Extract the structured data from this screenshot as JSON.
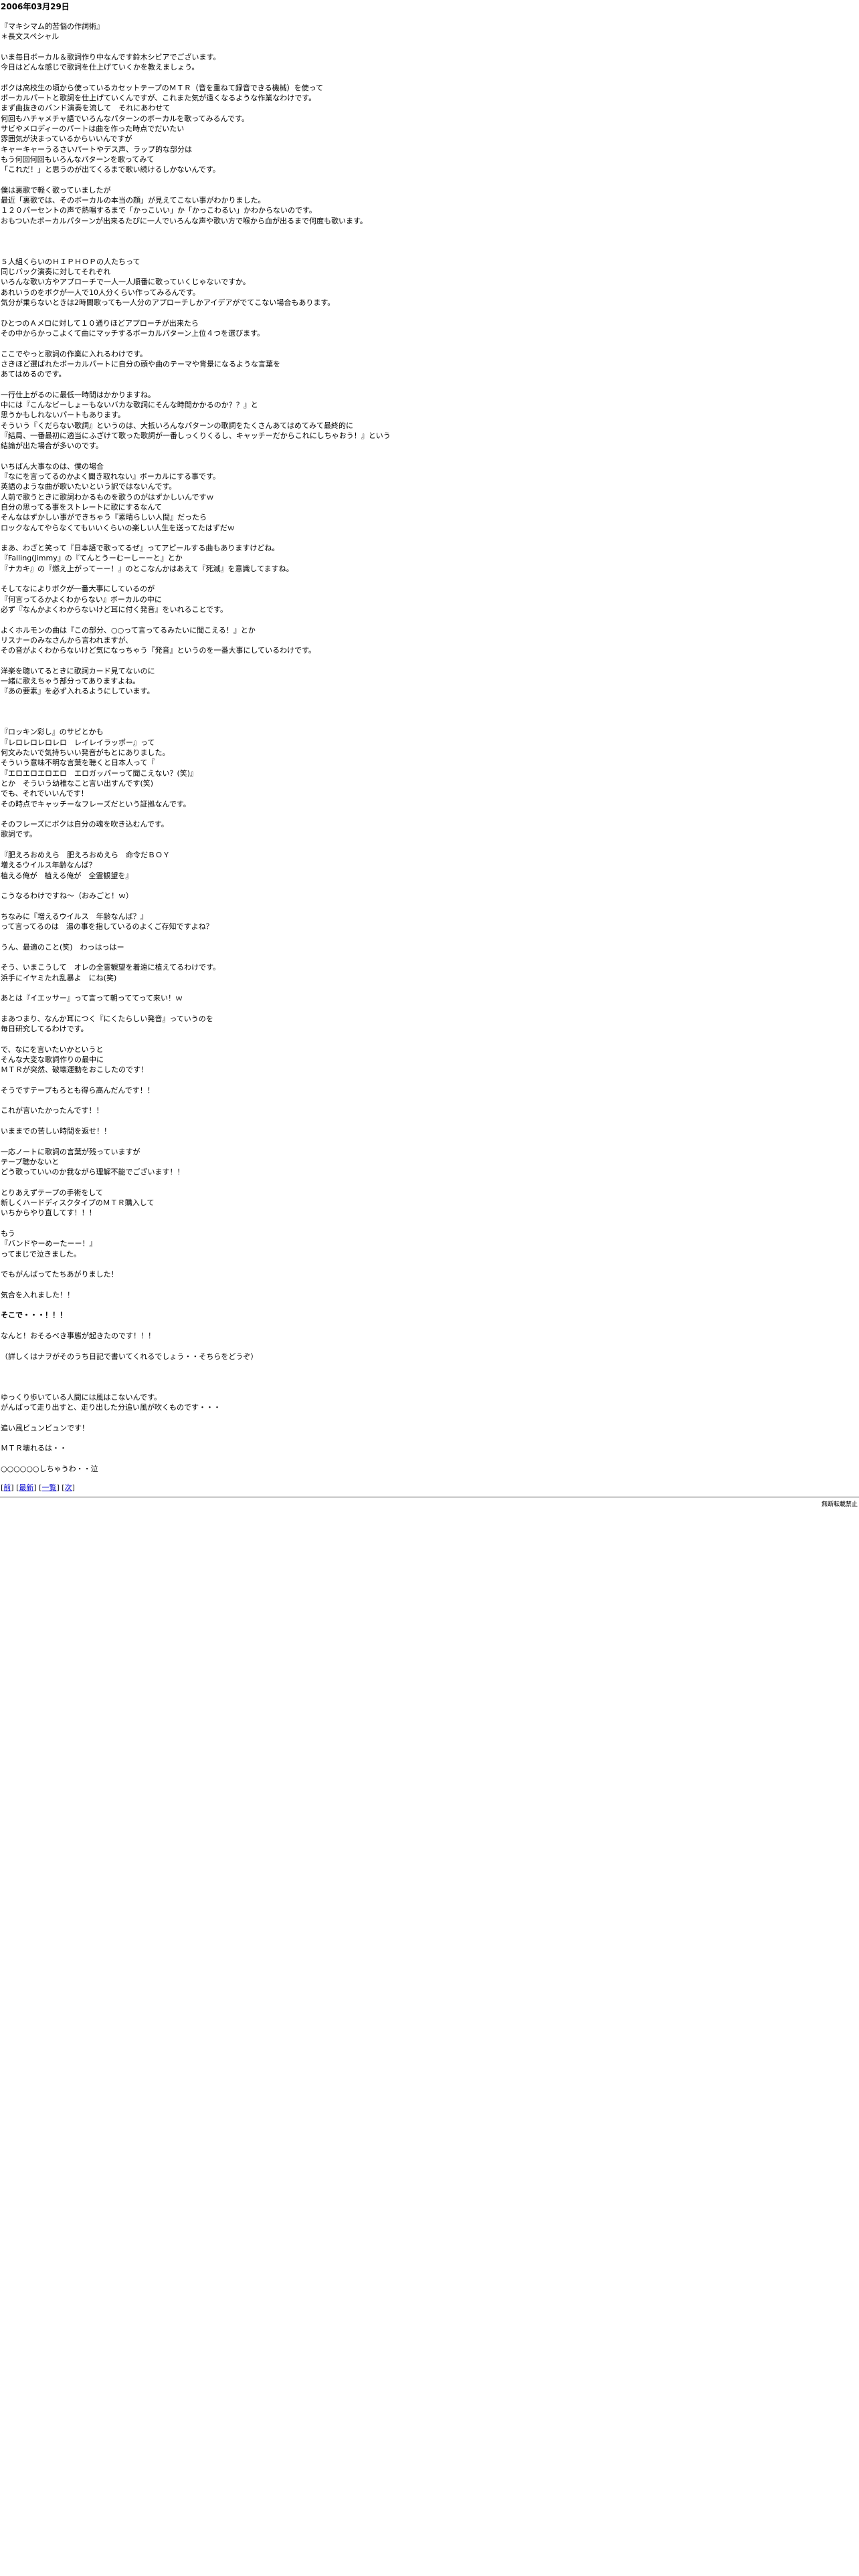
{
  "date": "2006年03月29日",
  "paragraphs": [
    "『マキシマム的苦悩の作詞術』\n＊長文スペシャル",
    "いま毎日ボーカル＆歌詞作り中なんです鈴木シビアでございます。\n今日はどんな感じで歌詞を仕上げていくかを教えましょう。",
    "ボクは高校生の頃から使っているカセットテープのＭＴＲ（音を重ねて録音できる機械）を使って\nボーカルパートと歌詞を仕上げていくんですが、これまた気が遠くなるような作業なわけです。\nまず曲抜きのバンド演奏を流して　それにあわせて\n何回もハチャメチャ語でいろんなパターンのボーカルを歌ってみるんです。\nサビやメロディーのパートは曲を作った時点でだいたい\n雰囲気が決まっているからいいんですが\nキャーキャーうるさいパートやデス声、ラップ的な部分は\nもう何回何回もいろんなパターンを歌ってみて\n「これだ！」と思うのが出てくるまで歌い続けるしかないんです。",
    "僕は裏歌で軽く歌っていましたが\n最近「裏歌では、そのボーカルの本当の顔」が見えてこない事がわかりました。\n１２０パーセントの声で熱唱するまで「かっこいい」か「かっこわるい」かわからないのです。\nおもついたボーカルパターンが出来るたびに一人でいろんな声や歌い方で喉から血が出るまで何度も歌います。",
    "",
    "５人組くらいのＨＩＰＨＯＰの人たちって\n同じバック演奏に対してそれぞれ\nいろんな歌い方やアプローチで一人一人順番に歌っていくじゃないですか。\nあれいうのをボクが一人で10人分くらい作ってみるんです。\n気分が乗らないときは2時間歌っても一人分のアプローチしかアイデアがでてこない場合もあります。",
    "ひとつのＡメロに対して１０通りほどアプローチが出来たら\nその中からかっこよくて曲にマッチするボーカルパターン上位４つを選びます。",
    "ここでやっと歌詞の作業に入れるわけです。\nさきほど選ばれたボーカルパートに自分の頭や曲のテーマや背景になるような言葉を\nあてはめるのです。",
    "一行仕上がるのに最低一時間はかかりますね。\n中には『こんなビーしょーもないバカな歌詞にそんな時間かかるのか？？』と\n思うかもしれないパートもあります。\nそういう『くだらない歌詞』というのは、大抵いろんなパターンの歌詞をたくさんあてはめてみて最終的に\n『結局、一番最初に適当にふざけて歌った歌詞が一番しっくりくるし、キャッチーだからこれにしちゃおう！』という\n結論が出た場合が多いのです。",
    "いちばん大事なのは、僕の場合\n『なにを言ってるのかよく聞き取れない』ボーカルにする事です。\n英語のような曲が歌いたいという訳ではないんです。\n人前で歌うときに歌詞わかるものを歌うのがはずかしいんですｗ\n自分の思ってる事をストレートに歌にするなんて\nそんなはずかしい事ができちゃう『素晴らしい人間』だったら\nロックなんてやらなくてもいいくらいの楽しい人生を送ってたはずだｗ",
    "まあ、わざと笑って『日本語で歌ってるぜ』ってアピールする曲もありますけどね。\n『Falling(Jimmy』の『てんとうーむーしーーと』とか\n『ナカキ』の『燃え上がってーー！』のとこなんかはあえて『死滅』を意識してますね。",
    "そしてなによりボクが一番大事にしているのが\n『何言ってるかよくわからない』ボーカルの中に\n必ず『なんかよくわからないけど耳に付く発音』をいれることです。",
    "よくホルモンの曲は『この部分、○○って言ってるみたいに聞こえる！』とか\nリスナーのみなさんから言われますが、\nその音がよくわからないけど気になっちゃう『発音』というのを一番大事にしているわけです。",
    "洋楽を聴いてるときに歌詞カード見てないのに\n一緒に歌えちゃう部分ってありますよね。\n『あの要素』を必ず入れるようにしています。",
    "",
    "『ロッキン彩し』のサビとかも\n『レロレロレロレロ　レイレイラッポー』って\n何文みたいで気持ちいい発音がもとにありました。\nそういう意味不明な言葉を聴くと日本人って『\n『エロエロエロエロ　エロガッパーって聞こえない？(笑)』\nとか　そういう幼稚なこと言い出すんです(笑)\nでも、それでいいんです！\nその時点でキャッチーなフレーズだという証拠なんです。",
    "そのフレーズにボクは自分の魂を吹き込むんです。\n歌詞です。",
    "『肥えろおめえら　肥えろおめえら　命令だＢＯＹ\n増えるウイルス年齢なんば？\n植える俺が　植える俺が　全霊観望を』",
    "こうなるわけですね～（おみごと！ｗ）",
    "ちなみに『増えるウイルス　年齢なんば？』\nって言ってるのは　湯の事を指しているのよくご存知ですよね？",
    "うん、最適のこと(笑)　わっはっはー",
    "そう、いまこうして　オレの全霊観望を着遠に植えてるわけです。\n浜手にイヤミたれ乱暴よ　にね(笑)",
    "あとは『イエッサー』って言って朝っててって来い！ｗ",
    "まあつまり、なんか耳につく『にくたらしい発音』っていうのを\n毎日研究してるわけです。",
    "で、なにを言いたいかというと\nそんな大変な歌詞作りの最中に\nＭＴＲが突然、破壊運動をおこしたのです！",
    "そうですテープもろとも得ら高んだんです！！",
    "これが言いたかったんです！！",
    "いままでの苦しい時間を返せ！！",
    "一応ノートに歌詞の言葉が残っていますが\nテープ聴かないと\nどう歌っていいのか我ながら理解不能でございます！！",
    "とりあえずテープの手術をして\n新しくハードディスクタイプのＭＴＲ購入して\nいちからやり直してす！！！",
    "もう\n『バンドやーめーたーー！』\nってまじで泣きました。",
    "でもがんばってたちあがりました！",
    "気合を入れました！！",
    "そこで・・・！！！",
    "なんと！おそるべき事態が起きたのです！！！",
    "（詳しくはナヲがそのうち日記で書いてくれるでしょう・・そちらをどうぞ）",
    "",
    "ゆっくり歩いている人間には風はこないんです。\nがんばって走り出すと、走り出した分追い風が吹くものです・・・",
    "追い風ビュンビュンです！",
    "ＭＴＲ壊れるは・・",
    "○○○○○○しちゃうわ・・泣"
  ],
  "bold_index": 33,
  "nav": {
    "open": "[",
    "sep": "] [",
    "close": "]",
    "prev": "前",
    "latest": "最新",
    "list": "一覧",
    "next": "次"
  },
  "footer": "無断転載禁止"
}
